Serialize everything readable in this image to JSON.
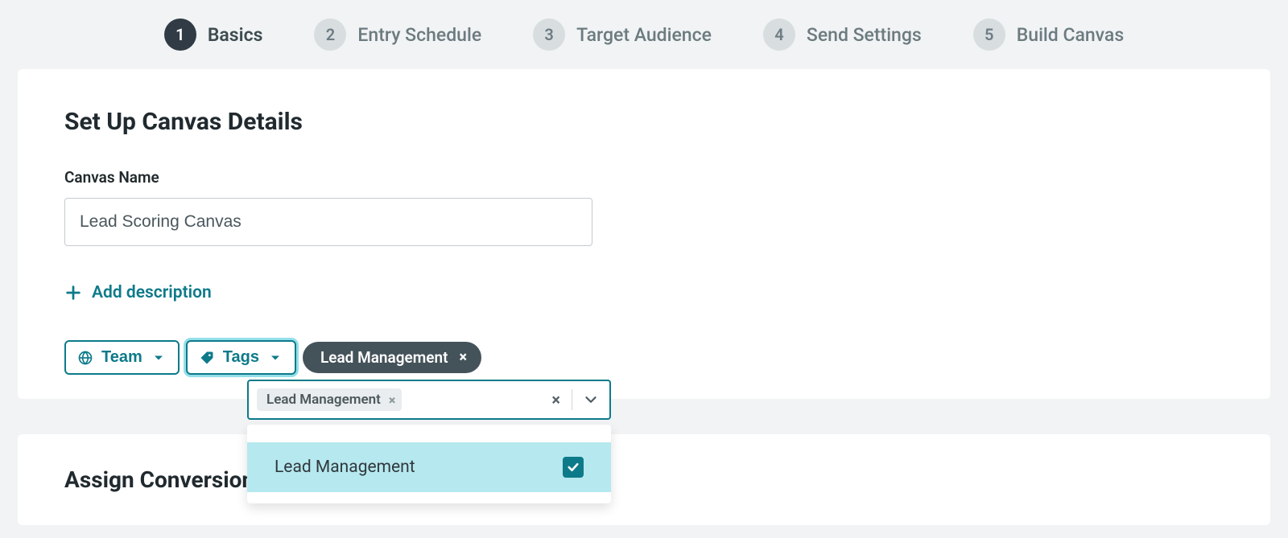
{
  "stepper": {
    "steps": [
      {
        "num": "1",
        "label": "Basics",
        "active": true
      },
      {
        "num": "2",
        "label": "Entry Schedule",
        "active": false
      },
      {
        "num": "3",
        "label": "Target Audience",
        "active": false
      },
      {
        "num": "4",
        "label": "Send Settings",
        "active": false
      },
      {
        "num": "5",
        "label": "Build Canvas",
        "active": false
      }
    ]
  },
  "card": {
    "title": "Set Up Canvas Details",
    "canvas_name_label": "Canvas Name",
    "canvas_name_value": "Lead Scoring Canvas",
    "add_description_label": "Add description",
    "team_button_label": "Team",
    "tags_button_label": "Tags",
    "applied_tag": "Lead Management"
  },
  "tags_combo": {
    "selected_chip": "Lead Management",
    "option_label": "Lead Management",
    "option_checked": true
  },
  "card2": {
    "title": "Assign Conversion Events"
  },
  "colors": {
    "teal": "#0d7a8a"
  }
}
